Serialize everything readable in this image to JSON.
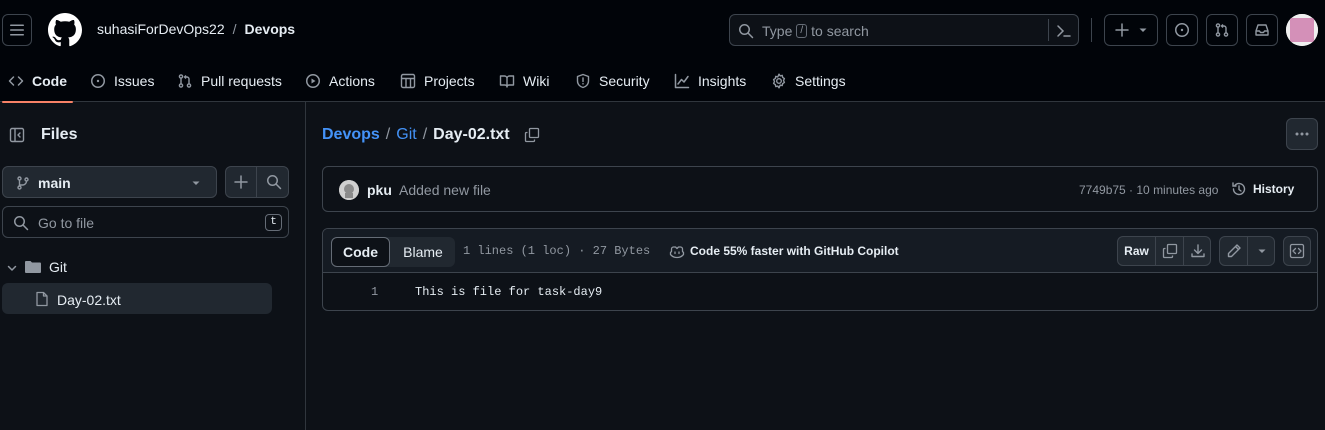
{
  "header": {
    "owner": "suhasiForDevOps22",
    "separator": "/",
    "repo": "Devops",
    "search_type": "Type",
    "search_key": "/",
    "search_to": "to search",
    "plus_label": "+"
  },
  "repo_nav": {
    "tabs": [
      {
        "label": "Code",
        "icon": "code-icon",
        "active": true
      },
      {
        "label": "Issues",
        "icon": "issue-icon"
      },
      {
        "label": "Pull requests",
        "icon": "pull-request-icon"
      },
      {
        "label": "Actions",
        "icon": "play-icon"
      },
      {
        "label": "Projects",
        "icon": "table-icon"
      },
      {
        "label": "Wiki",
        "icon": "book-icon"
      },
      {
        "label": "Security",
        "icon": "shield-icon"
      },
      {
        "label": "Insights",
        "icon": "graph-icon"
      },
      {
        "label": "Settings",
        "icon": "gear-icon"
      }
    ]
  },
  "sidebar": {
    "title": "Files",
    "branch": "main",
    "goto_placeholder": "Go to file",
    "goto_shortcut": "t",
    "tree": [
      {
        "name": "Git",
        "type": "folder",
        "expanded": true
      },
      {
        "name": "Day-02.txt",
        "type": "file",
        "selected": true
      }
    ]
  },
  "breadcrumb": {
    "root": "Devops",
    "sep1": "/",
    "folder": "Git",
    "sep2": "/",
    "file": "Day-02.txt"
  },
  "commit": {
    "author": "pku",
    "message": "Added new file",
    "sha_time": "7749b75 · 10 minutes ago",
    "history_label": "History"
  },
  "file_view": {
    "tab_code": "Code",
    "tab_blame": "Blame",
    "meta": "1 lines (1 loc) · 27 Bytes",
    "copilot": "Code 55% faster with GitHub Copilot",
    "raw_label": "Raw",
    "lines": [
      {
        "number": "1",
        "text": "This is file for task-day9"
      }
    ]
  },
  "colors": {
    "background": "#0d1117",
    "header_bg": "#010409",
    "border": "#30363d",
    "accent_tab": "#f78166",
    "link": "#4493f8"
  }
}
